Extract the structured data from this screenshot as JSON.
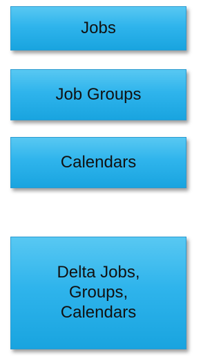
{
  "boxes": {
    "jobs": "Jobs",
    "job_groups": "Job Groups",
    "calendars": "Calendars",
    "delta": "Delta Jobs,\nGroups,\nCalendars"
  }
}
